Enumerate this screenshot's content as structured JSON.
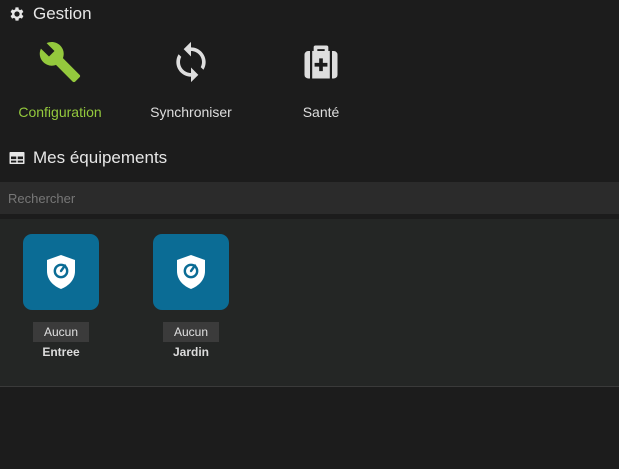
{
  "sections": {
    "gestion": "Gestion",
    "equipments": "Mes équipements"
  },
  "management": [
    {
      "label": "Configuration",
      "icon": "wrench-icon",
      "active": true
    },
    {
      "label": "Synchroniser",
      "icon": "sync-icon"
    },
    {
      "label": "Santé",
      "icon": "medkit-icon"
    }
  ],
  "search": {
    "placeholder": "Rechercher",
    "value": ""
  },
  "devices": [
    {
      "badge": "Aucun",
      "name": "Entree",
      "icon": "shield-icon"
    },
    {
      "badge": "Aucun",
      "name": "Jardin",
      "icon": "shield-icon"
    }
  ],
  "colors": {
    "accent": "#94c93d",
    "tile": "#0b6c95",
    "background": "#1c1c1c"
  }
}
